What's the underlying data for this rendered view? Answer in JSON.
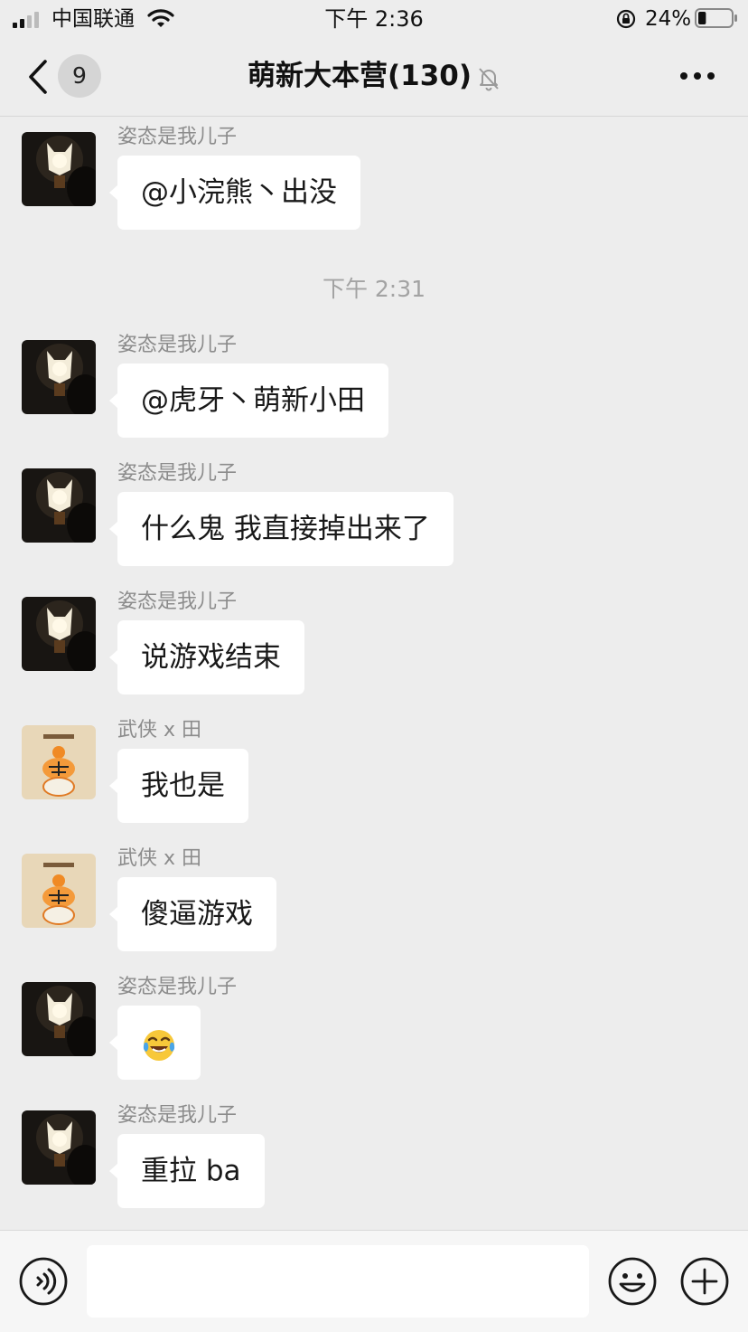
{
  "status_bar": {
    "carrier": "中国联通",
    "time": "下午 2:36",
    "battery_percent": "24%",
    "battery_level": 0.24
  },
  "nav": {
    "unread_count": "9",
    "title": "萌新大本营(130)",
    "muted": true
  },
  "chat": {
    "time_divider": "下午 2:31",
    "messages": [
      {
        "sender": "姿态是我儿子",
        "text": "@小浣熊丶出没",
        "avatar": "lantern-avatar"
      },
      {
        "sender": "姿态是我儿子",
        "text": "@虎牙丶萌新小田",
        "avatar": "lantern-avatar"
      },
      {
        "sender": "姿态是我儿子",
        "text": "什么鬼  我直接掉出来了",
        "avatar": "lantern-avatar"
      },
      {
        "sender": "姿态是我儿子",
        "text": "说游戏结束",
        "avatar": "lantern-avatar"
      },
      {
        "sender": "武侠 x 田",
        "text": "我也是",
        "avatar": "tiger-avatar"
      },
      {
        "sender": "武侠 x 田",
        "text": "傻逼游戏",
        "avatar": "tiger-avatar"
      },
      {
        "sender": "姿态是我儿子",
        "text": "",
        "emoji": "crying-laughing-emoji",
        "avatar": "lantern-avatar"
      },
      {
        "sender": "姿态是我儿子",
        "text": "重拉 ba",
        "avatar": "lantern-avatar"
      }
    ]
  },
  "input_bar": {
    "value": "",
    "placeholder": ""
  },
  "icons": {
    "back": "chevron-left-icon",
    "mute": "bell-off-icon",
    "more": "more-dots-icon",
    "voice": "voice-icon",
    "emoji": "smiley-icon",
    "plus": "plus-circle-icon"
  },
  "colors": {
    "background": "#ededed",
    "bubble": "#ffffff",
    "sender_text": "#8c8c8c",
    "badge": "#d5d5d5"
  }
}
